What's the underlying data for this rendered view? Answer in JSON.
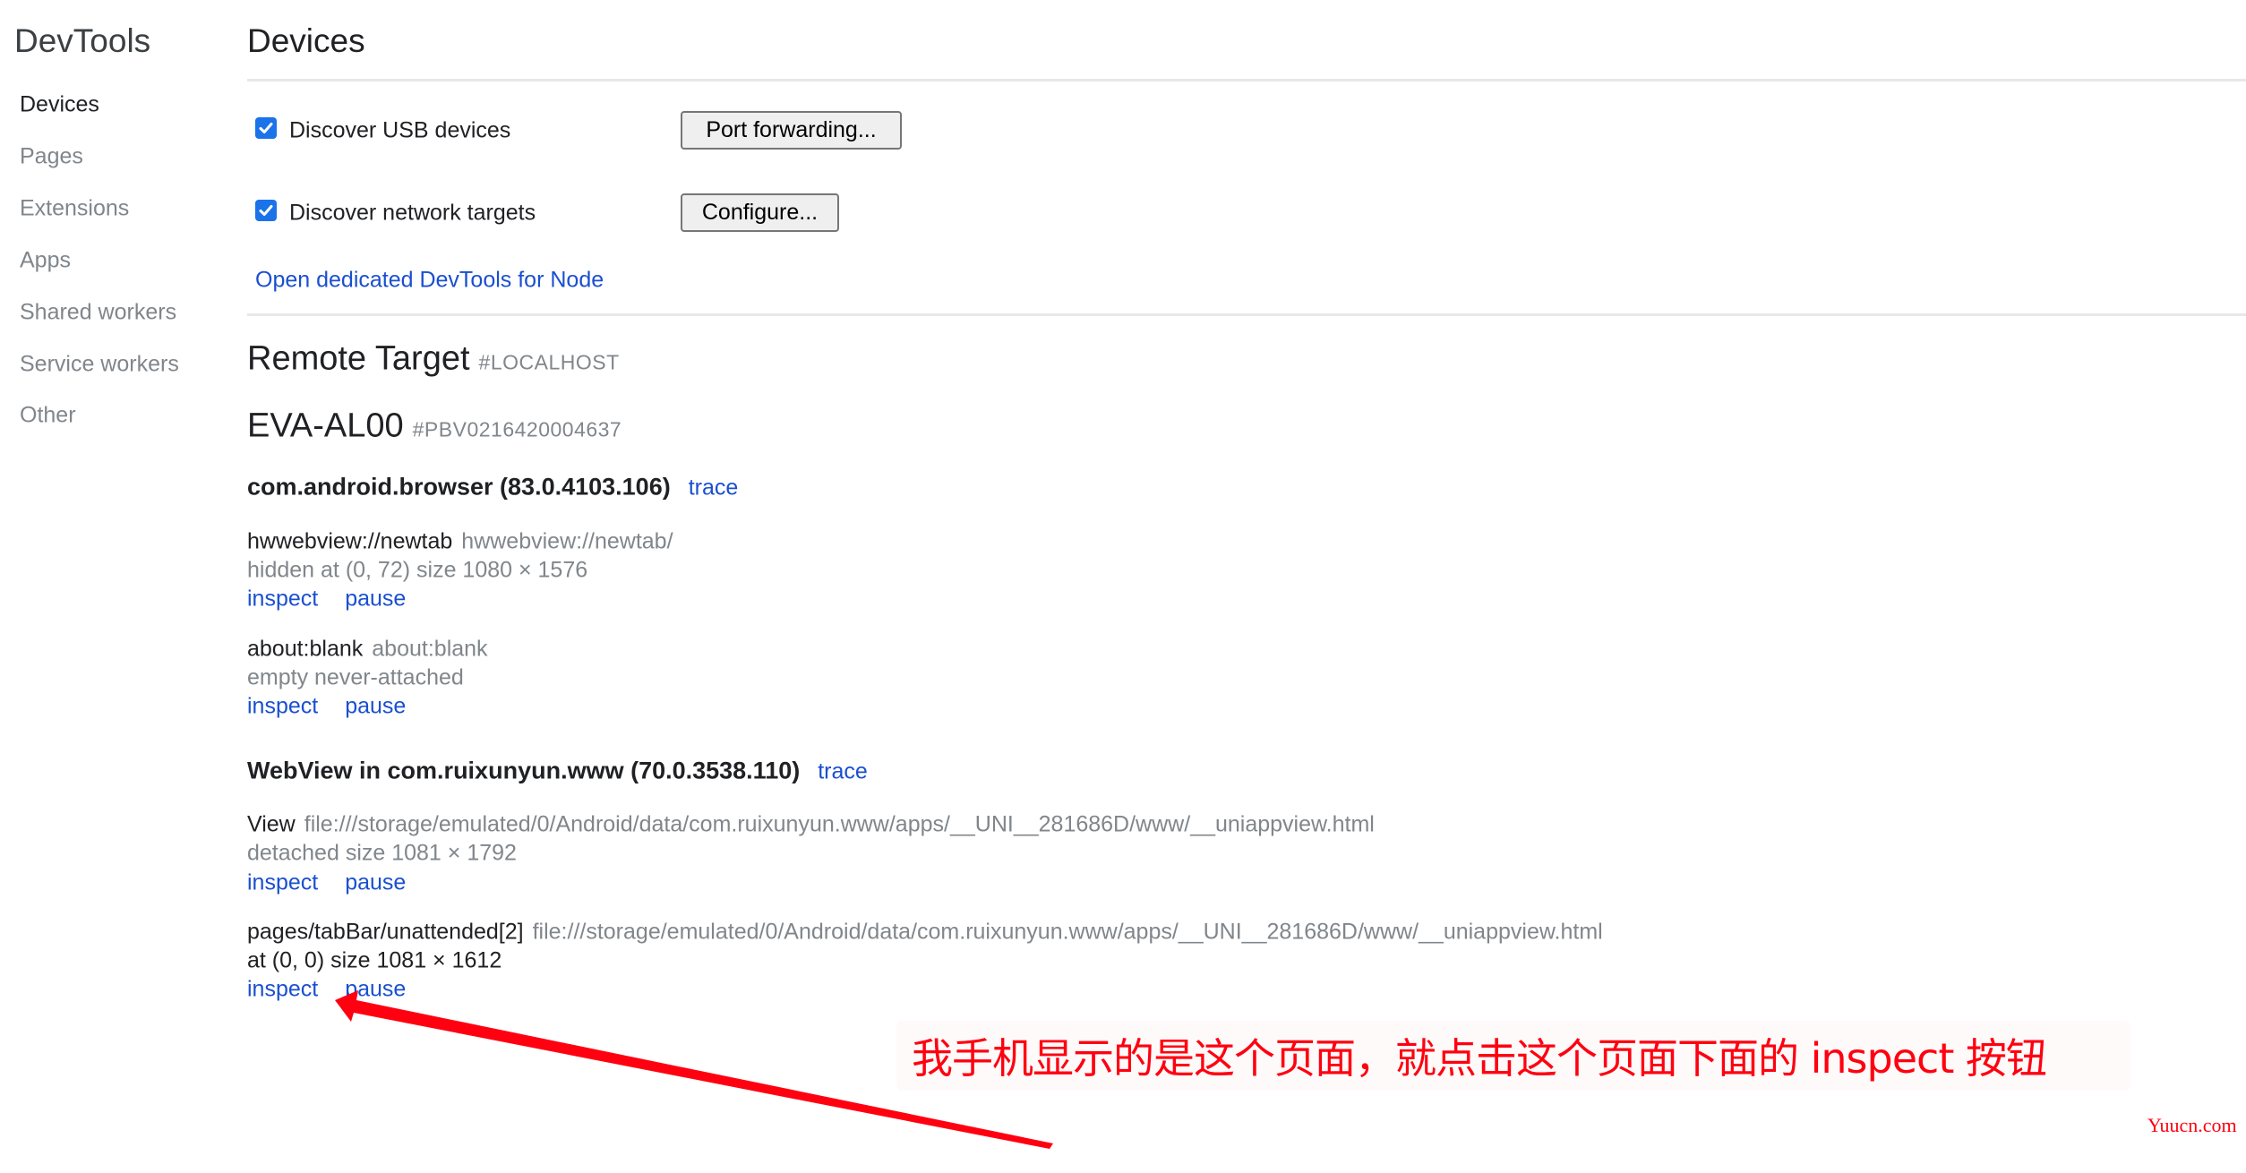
{
  "app": {
    "title": "DevTools"
  },
  "sidebar": {
    "items": [
      {
        "label": "Devices",
        "active": true
      },
      {
        "label": "Pages",
        "active": false
      },
      {
        "label": "Extensions",
        "active": false
      },
      {
        "label": "Apps",
        "active": false
      },
      {
        "label": "Shared workers",
        "active": false
      },
      {
        "label": "Service workers",
        "active": false
      },
      {
        "label": "Other",
        "active": false
      }
    ]
  },
  "devices": {
    "title": "Devices",
    "discover_usb": {
      "label": "Discover USB devices",
      "checked": true,
      "button": "Port forwarding..."
    },
    "discover_network": {
      "label": "Discover network targets",
      "checked": true,
      "button": "Configure..."
    },
    "node_link": "Open dedicated DevTools for Node"
  },
  "remote_target": {
    "title": "Remote Target",
    "host": "#LOCALHOST",
    "device": {
      "name": "EVA-AL00",
      "serial": "#PBV0216420004637"
    },
    "browsers": [
      {
        "name": "com.android.browser (83.0.4103.106)",
        "trace": "trace",
        "targets": [
          {
            "name": "hwwebview://newtab",
            "url": "hwwebview://newtab/",
            "status": "hidden  at (0, 72)  size 1080 × 1576",
            "status_dim": true,
            "inspect": "inspect",
            "pause": "pause"
          },
          {
            "name": "about:blank",
            "url": "about:blank",
            "status": "empty never-attached",
            "status_dim": true,
            "inspect": "inspect",
            "pause": "pause"
          }
        ]
      },
      {
        "name": "WebView in com.ruixunyun.www (70.0.3538.110)",
        "trace": "trace",
        "targets": [
          {
            "name": "View",
            "url": "file:///storage/emulated/0/Android/data/com.ruixunyun.www/apps/__UNI__281686D/www/__uniappview.html",
            "status": "detached  size 1081 × 1792",
            "status_dim": true,
            "inspect": "inspect",
            "pause": "pause"
          },
          {
            "name": "pages/tabBar/unattended[2]",
            "url": "file:///storage/emulated/0/Android/data/com.ruixunyun.www/apps/__UNI__281686D/www/__uniappview.html",
            "status": "at (0, 0)  size 1081 × 1612",
            "status_dim": false,
            "inspect": "inspect",
            "pause": "pause"
          }
        ]
      }
    ]
  },
  "annotation": {
    "text": "我手机显示的是这个页面，就点击这个页面下面的 inspect 按钮",
    "color": "#ff0010"
  },
  "watermark": "Yuucn.com",
  "colors": {
    "link": "#1a4fd0",
    "checkbox": "#1a73e8",
    "muted": "#80868b",
    "text": "#202124"
  }
}
